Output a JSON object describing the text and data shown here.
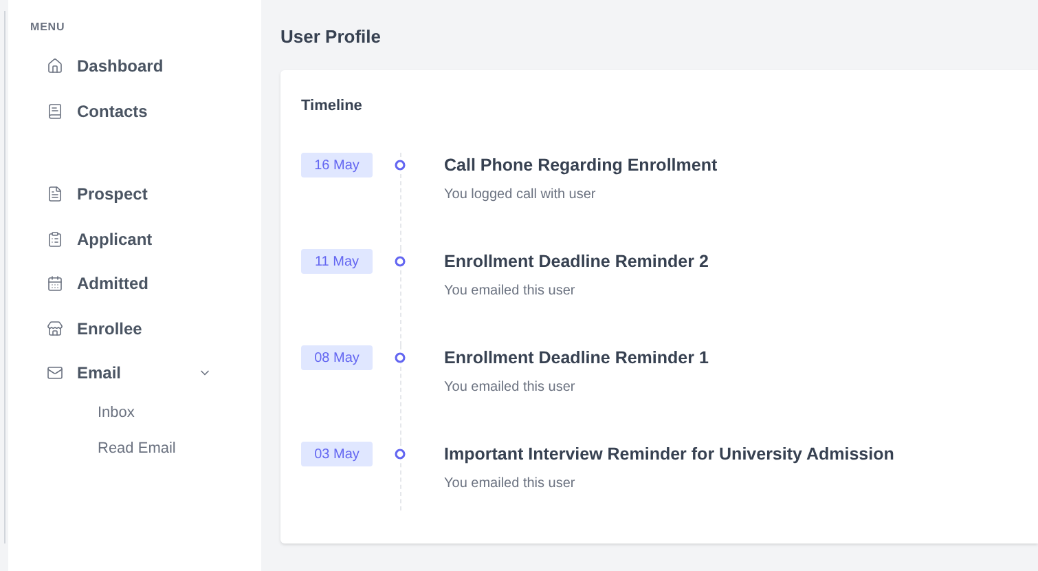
{
  "sidebar": {
    "heading": "MENU",
    "groups": [
      {
        "items": [
          {
            "label": "Dashboard"
          },
          {
            "label": "Contacts"
          }
        ]
      },
      {
        "items": [
          {
            "label": "Prospect"
          },
          {
            "label": "Applicant"
          },
          {
            "label": "Admitted"
          },
          {
            "label": "Enrollee"
          },
          {
            "label": "Email",
            "expanded": true,
            "children": [
              {
                "label": "Inbox"
              },
              {
                "label": "Read Email"
              }
            ]
          }
        ]
      }
    ]
  },
  "page": {
    "title": "User Profile"
  },
  "timeline": {
    "title": "Timeline",
    "events": [
      {
        "date": "16 May",
        "title": "Call Phone Regarding Enrollment",
        "detail": "You logged call with user"
      },
      {
        "date": "11 May",
        "title": "Enrollment Deadline Reminder 2",
        "detail": "You emailed this user"
      },
      {
        "date": "08 May",
        "title": "Enrollment Deadline Reminder 1",
        "detail": "You emailed this user"
      },
      {
        "date": "03 May",
        "title": "Important Interview Reminder for University Admission",
        "detail": "You emailed this user"
      }
    ]
  }
}
